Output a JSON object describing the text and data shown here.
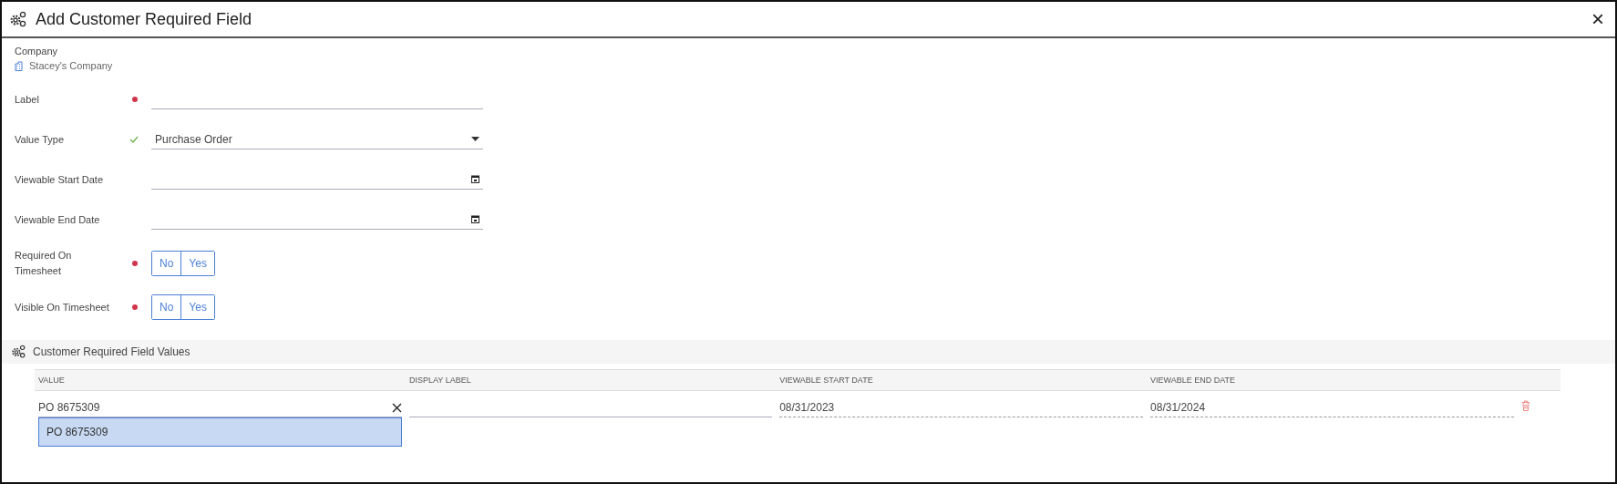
{
  "window": {
    "title": "Add Customer Required Field",
    "close": "×"
  },
  "company": {
    "label": "Company",
    "name": "Stacey's Company"
  },
  "fields": [
    {
      "kind": "text",
      "label": "Label",
      "required": true
    },
    {
      "kind": "select",
      "label": "Value Type",
      "valid": true,
      "value": "Purchase Order"
    },
    {
      "kind": "date",
      "label": "Viewable Start Date"
    },
    {
      "kind": "date",
      "label": "Viewable End Date"
    },
    {
      "kind": "toggle",
      "label": "Required On Timesheet",
      "required": true,
      "options": [
        {
          "label": "No",
          "selected": false
        },
        {
          "label": "Yes",
          "selected": false
        }
      ]
    },
    {
      "kind": "toggle",
      "label": "Visible On Timesheet",
      "required": true,
      "options": [
        {
          "label": "No",
          "selected": false
        },
        {
          "label": "Yes",
          "selected": false
        }
      ]
    }
  ],
  "values_section": {
    "title": "Customer Required Field Values",
    "table": {
      "columns": [
        "VALUE",
        "DISPLAY LABEL",
        "VIEWABLE START DATE",
        "VIEWABLE END DATE"
      ],
      "rows": [
        {
          "value": "PO 8675309",
          "start_date": "08/31/2023",
          "end_date": "08/31/2024"
        }
      ]
    },
    "suggestions": [
      {
        "label": "PO 8675309",
        "selected": true
      }
    ]
  }
}
